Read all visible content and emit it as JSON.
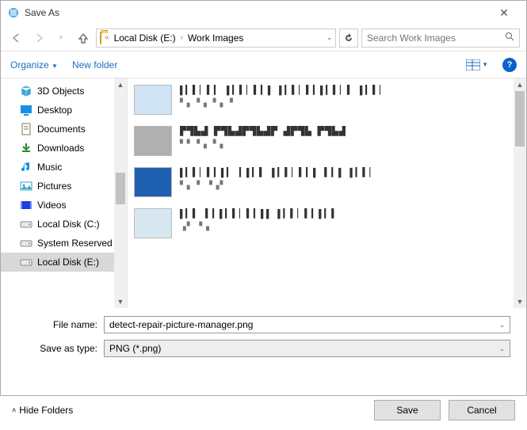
{
  "window": {
    "title": "Save As"
  },
  "nav": {
    "breadcrumb_prefix": "«",
    "crumb1": "Local Disk (E:)",
    "crumb2": "Work Images",
    "search_placeholder": "Search Work Images"
  },
  "toolbar": {
    "organize": "Organize",
    "new_folder": "New folder",
    "help": "?"
  },
  "tree": {
    "items": [
      {
        "label": "3D Objects",
        "icon": "cube",
        "color": "#3aa7d8"
      },
      {
        "label": "Desktop",
        "icon": "desktop",
        "color": "#1a8fe3"
      },
      {
        "label": "Documents",
        "icon": "doc",
        "color": "#7a7a55"
      },
      {
        "label": "Downloads",
        "icon": "download",
        "color": "#2c8a2c"
      },
      {
        "label": "Music",
        "icon": "music",
        "color": "#1a8fe3"
      },
      {
        "label": "Pictures",
        "icon": "pictures",
        "color": "#33a7c7"
      },
      {
        "label": "Videos",
        "icon": "video",
        "color": "#1a3fe3"
      },
      {
        "label": "Local Disk (C:)",
        "icon": "disk",
        "color": "#8a8a8a"
      },
      {
        "label": "System Reserved",
        "icon": "disk",
        "color": "#8a8a8a"
      },
      {
        "label": "Local Disk (E:)",
        "icon": "disk",
        "color": "#8a8a8a",
        "selected": true
      }
    ]
  },
  "files": {
    "items": [
      {
        "name_obscured": "▌▎▍▏▍▎ ▌▎▍▏▍▎▌  ▌▎▍▏▍▎▌▎▍▏▍ ▌▎▍▏",
        "meta_obscured": "▘▖▝▗ ▘▖▝",
        "thumb": "#cfe3f5"
      },
      {
        "name_obscured": "▛▜▙▟ ▛▜▙▟▛▜▙▟▛  ▟▛▜▙  ▛▜▙▟",
        "meta_obscured": "▘▘▝▗ ▘▖",
        "thumb": "#b0b0b0"
      },
      {
        "name_obscured": "▌▎▍▏▍▎▌▎ ▎▌▎▍ ▌▎▍▏▍▎▌ ▍▎▌ ▌▎▍▏",
        "meta_obscured": "▘▖▝ ▝▗▘",
        "thumb": "#1f5fb0"
      },
      {
        "name_obscured": "▌▎▍ ▍▎▌▎▍▏▍▎▌▌  ▌▎▍▏▍▎▌▎▍",
        "meta_obscured": "▗▘ ▘▖",
        "thumb": "#d7e8f2"
      }
    ]
  },
  "form": {
    "filename_label": "File name:",
    "filename_value": "detect-repair-picture-manager.png",
    "type_label": "Save as type:",
    "type_value": "PNG (*.png)"
  },
  "footer": {
    "hide_folders": "Hide Folders",
    "save": "Save",
    "cancel": "Cancel"
  }
}
